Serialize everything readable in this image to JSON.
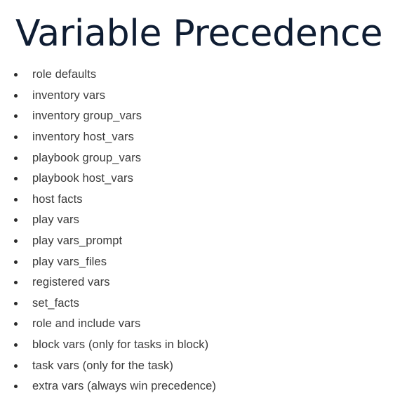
{
  "slide": {
    "title": "Variable Precedence",
    "items": [
      {
        "label": "role defaults"
      },
      {
        "label": "inventory vars"
      },
      {
        "label": "inventory group_vars"
      },
      {
        "label": "inventory host_vars"
      },
      {
        "label": "playbook group_vars"
      },
      {
        "label": "playbook host_vars"
      },
      {
        "label": "host facts"
      },
      {
        "label": "play vars"
      },
      {
        "label": "play vars_prompt"
      },
      {
        "label": "play vars_files"
      },
      {
        "label": "registered vars"
      },
      {
        "label": "set_facts"
      },
      {
        "label": "role and include vars"
      },
      {
        "label": "block vars (only for tasks in block)"
      },
      {
        "label": "task vars (only for the task)"
      },
      {
        "label": "extra vars (always win precedence)"
      }
    ]
  },
  "colors": {
    "title": "#0f1d33",
    "text": "#3a3a3a",
    "bullet": "#2a2a2a",
    "background": "#ffffff"
  }
}
